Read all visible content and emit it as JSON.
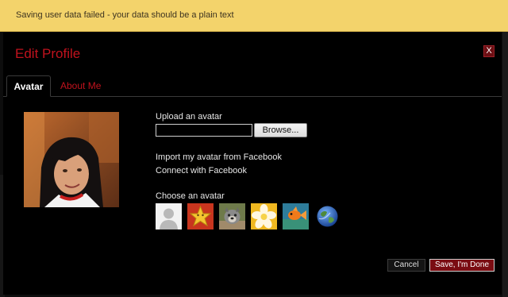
{
  "banner": {
    "message": "Saving user data failed - your data should be a plain text"
  },
  "dialog": {
    "title": "Edit Profile",
    "close_label": "X",
    "tabs": [
      {
        "label": "Avatar",
        "active": true
      },
      {
        "label": "About Me",
        "active": false
      }
    ]
  },
  "avatar_tab": {
    "upload_label": "Upload an avatar",
    "browse_label": "Browse...",
    "upload_value": "",
    "import_facebook": "Import my avatar from Facebook",
    "connect_facebook": "Connect with Facebook",
    "choose_label": "Choose an avatar",
    "choices": [
      {
        "icon": "default-person-icon"
      },
      {
        "icon": "gold-star-icon"
      },
      {
        "icon": "dog-icon"
      },
      {
        "icon": "flower-icon"
      },
      {
        "icon": "goldfish-icon"
      },
      {
        "icon": "earth-globe-icon"
      }
    ]
  },
  "footer": {
    "cancel_label": "Cancel",
    "save_label": "Save, I'm Done"
  },
  "colors": {
    "banner_bg": "#f3d36b",
    "accent_red": "#c1121d",
    "modal_bg": "#000000"
  }
}
